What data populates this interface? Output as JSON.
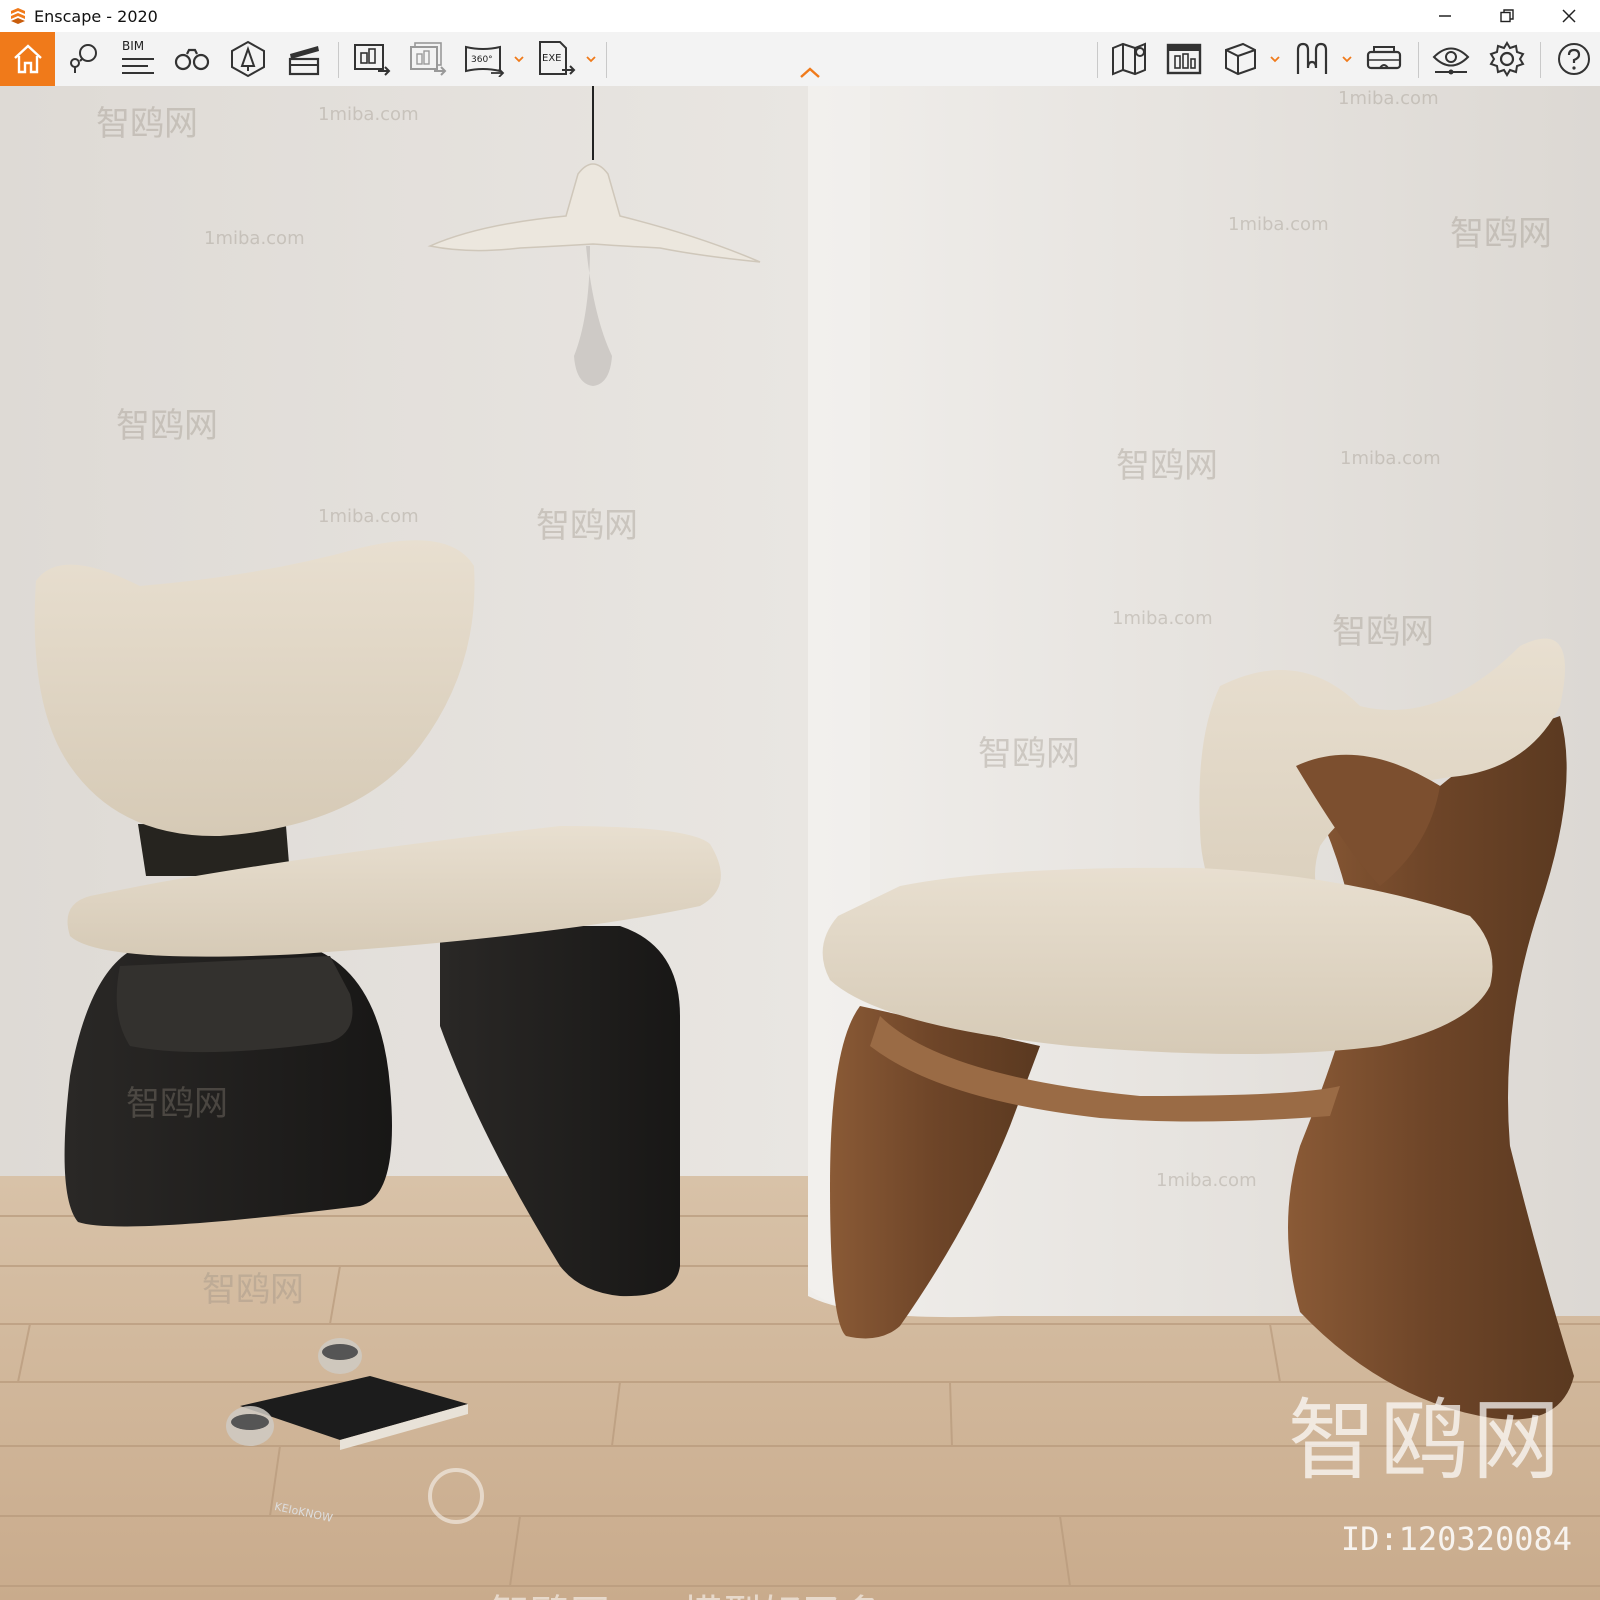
{
  "window": {
    "title": "Enscape - 2020",
    "controls": [
      "minimize",
      "restore",
      "close"
    ]
  },
  "toolbar": {
    "accent_color": "#f07a1a",
    "left_tools": [
      {
        "icon": "home-icon"
      },
      {
        "icon": "views-icon"
      },
      {
        "icon": "bim-icon",
        "label": "BIM"
      },
      {
        "icon": "binoculars-icon"
      },
      {
        "icon": "asset-library-icon"
      },
      {
        "icon": "clapper-icon"
      },
      {
        "icon": "render-image-icon"
      },
      {
        "icon": "batch-render-icon"
      },
      {
        "icon": "panorama-360-icon",
        "label": "360°"
      },
      {
        "icon": "export-exe-icon",
        "label": "EXE"
      }
    ],
    "right_tools": [
      {
        "icon": "map-icon"
      },
      {
        "icon": "image-sheet-icon"
      },
      {
        "icon": "cube-icon"
      },
      {
        "icon": "material-icon"
      },
      {
        "icon": "vr-headset-icon"
      },
      {
        "icon": "visual-settings-icon"
      },
      {
        "icon": "settings-gear-icon"
      },
      {
        "icon": "help-icon"
      }
    ]
  },
  "watermarks": {
    "site": "1miba.com",
    "brand": "智鸥网",
    "slogan": "智鸥网-----模型好又多----",
    "id": "ID:120320084",
    "book_title": "KEIoKNOW"
  }
}
